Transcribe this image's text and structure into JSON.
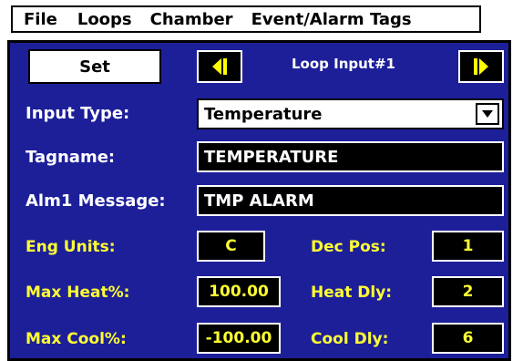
{
  "menu": {
    "items": [
      "File",
      "Loops",
      "Chamber",
      "Event/Alarm Tags"
    ]
  },
  "toolbar": {
    "set_label": "Set",
    "prev_icon": "step-back-icon",
    "next_icon": "step-forward-icon",
    "title": "Loop Input#1"
  },
  "form": {
    "input_type": {
      "label": "Input Type:",
      "value": "Temperature"
    },
    "tagname": {
      "label": "Tagname:",
      "value": "TEMPERATURE"
    },
    "alm1_message": {
      "label": "Alm1 Message:",
      "value": "TMP ALARM"
    },
    "eng_units": {
      "label": "Eng Units:",
      "value": "C"
    },
    "dec_pos": {
      "label": "Dec Pos:",
      "value": "1"
    },
    "max_heat": {
      "label": "Max Heat%:",
      "value": "100.00"
    },
    "heat_dly": {
      "label": "Heat Dly:",
      "value": "2"
    },
    "max_cool": {
      "label": "Max Cool%:",
      "value": "-100.00"
    },
    "cool_dly": {
      "label": "Cool Dly:",
      "value": "6"
    }
  },
  "colors": {
    "panel": "#1d1f99",
    "label_white": "#ffffff",
    "label_yellow": "#ffff33",
    "field_dark": "#000000"
  }
}
